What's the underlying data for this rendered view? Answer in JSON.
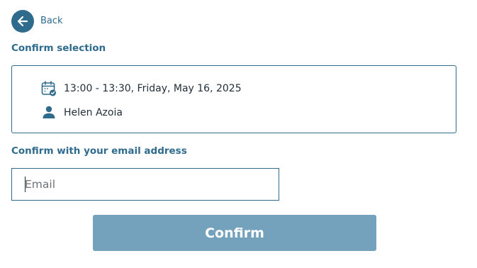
{
  "nav": {
    "back_label": "Back",
    "back_icon": "arrow-left-icon"
  },
  "selection": {
    "title": "Confirm selection",
    "time_icon": "calendar-check-icon",
    "time_text": "13:00 - 13:30, Friday, May 16, 2025",
    "person_icon": "person-icon",
    "person_name": "Helen Azoia"
  },
  "email_section": {
    "title": "Confirm with your email address",
    "placeholder": "Email",
    "value": ""
  },
  "actions": {
    "confirm_label": "Confirm"
  },
  "colors": {
    "accent": "#2f6b8d",
    "button_disabled": "#74a1bb"
  }
}
